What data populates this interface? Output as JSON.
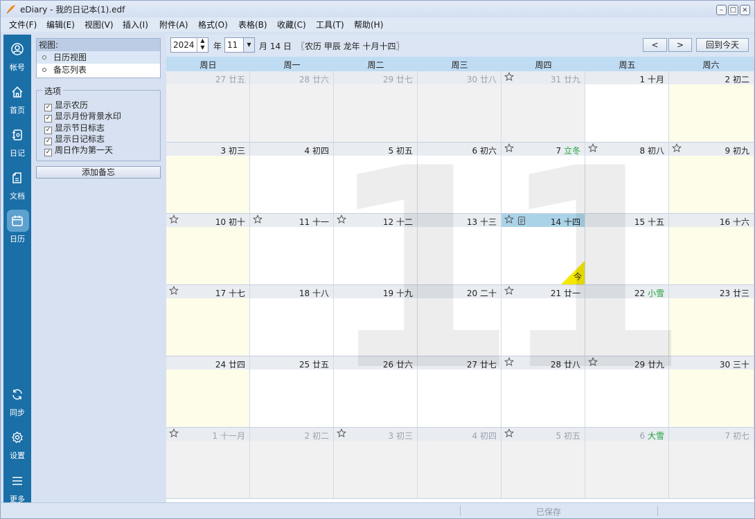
{
  "window": {
    "title": "eDiary - 我的日记本(1).edf"
  },
  "menu": [
    "文件(F)",
    "编辑(E)",
    "视图(V)",
    "插入(I)",
    "附件(A)",
    "格式(O)",
    "表格(B)",
    "收藏(C)",
    "工具(T)",
    "帮助(H)"
  ],
  "sidebar": {
    "items": [
      {
        "label": "帐号",
        "icon": "account-icon"
      },
      {
        "label": "首页",
        "icon": "home-icon"
      },
      {
        "label": "日记",
        "icon": "diary-icon"
      },
      {
        "label": "文档",
        "icon": "document-icon"
      },
      {
        "label": "日历",
        "icon": "calendar-icon",
        "active": true
      },
      {
        "label": "同步",
        "icon": "sync-icon"
      },
      {
        "label": "设置",
        "icon": "settings-icon"
      },
      {
        "label": "更多",
        "icon": "menu-icon"
      }
    ]
  },
  "panel": {
    "view_title": "视图:",
    "views": [
      "日历视图",
      "备忘列表"
    ],
    "options_title": "选项",
    "options": [
      {
        "label": "显示农历",
        "checked": true
      },
      {
        "label": "显示月份背景水印",
        "checked": true
      },
      {
        "label": "显示节日标志",
        "checked": true
      },
      {
        "label": "显示日记标志",
        "checked": true
      },
      {
        "label": "周日作为第一天",
        "checked": true
      }
    ],
    "add_memo": "添加备忘"
  },
  "toolbar": {
    "year": "2024",
    "year_unit": "年",
    "month": "11",
    "month_day": "月 14 日",
    "lunar_info": "〖农历 甲辰 龙年 十月十四〗",
    "prev": "<",
    "next": ">",
    "today": "回到今天"
  },
  "calendar": {
    "watermark": "11",
    "weekdays": [
      "周日",
      "周一",
      "周二",
      "周三",
      "周四",
      "周五",
      "周六"
    ],
    "today_badge": "今",
    "weeks": [
      [
        {
          "d": "27",
          "l": "廿五",
          "other": true
        },
        {
          "d": "28",
          "l": "廿六",
          "other": true
        },
        {
          "d": "29",
          "l": "廿七",
          "other": true
        },
        {
          "d": "30",
          "l": "廿八",
          "other": true
        },
        {
          "d": "31",
          "l": "廿九",
          "other": true,
          "star": true
        },
        {
          "d": "1",
          "l": "十月"
        },
        {
          "d": "2",
          "l": "初二",
          "weekend": true
        }
      ],
      [
        {
          "d": "3",
          "l": "初三",
          "weekend": true
        },
        {
          "d": "4",
          "l": "初四"
        },
        {
          "d": "5",
          "l": "初五"
        },
        {
          "d": "6",
          "l": "初六"
        },
        {
          "d": "7",
          "l": "立冬",
          "term": true,
          "star": true
        },
        {
          "d": "8",
          "l": "初八",
          "star": true
        },
        {
          "d": "9",
          "l": "初九",
          "weekend": true,
          "star": true
        }
      ],
      [
        {
          "d": "10",
          "l": "初十",
          "weekend": true,
          "star": true
        },
        {
          "d": "11",
          "l": "十一",
          "star": true
        },
        {
          "d": "12",
          "l": "十二",
          "star": true
        },
        {
          "d": "13",
          "l": "十三"
        },
        {
          "d": "14",
          "l": "十四",
          "today": true,
          "star": true,
          "note": true
        },
        {
          "d": "15",
          "l": "十五"
        },
        {
          "d": "16",
          "l": "十六",
          "weekend": true
        }
      ],
      [
        {
          "d": "17",
          "l": "十七",
          "weekend": true,
          "star": true
        },
        {
          "d": "18",
          "l": "十八"
        },
        {
          "d": "19",
          "l": "十九"
        },
        {
          "d": "20",
          "l": "二十"
        },
        {
          "d": "21",
          "l": "廿一",
          "star": true
        },
        {
          "d": "22",
          "l": "小雪",
          "term": true
        },
        {
          "d": "23",
          "l": "廿三",
          "weekend": true
        }
      ],
      [
        {
          "d": "24",
          "l": "廿四",
          "weekend": true
        },
        {
          "d": "25",
          "l": "廿五"
        },
        {
          "d": "26",
          "l": "廿六"
        },
        {
          "d": "27",
          "l": "廿七"
        },
        {
          "d": "28",
          "l": "廿八",
          "star": true
        },
        {
          "d": "29",
          "l": "廿九",
          "star": true
        },
        {
          "d": "30",
          "l": "三十",
          "weekend": true
        }
      ],
      [
        {
          "d": "1",
          "l": "十一月",
          "other": true,
          "star": true
        },
        {
          "d": "2",
          "l": "初二",
          "other": true
        },
        {
          "d": "3",
          "l": "初三",
          "other": true,
          "star": true
        },
        {
          "d": "4",
          "l": "初四",
          "other": true
        },
        {
          "d": "5",
          "l": "初五",
          "other": true,
          "star": true
        },
        {
          "d": "6",
          "l": "大雪",
          "other": true,
          "term": true
        },
        {
          "d": "7",
          "l": "初七",
          "other": true
        }
      ]
    ]
  },
  "status": {
    "saved": "已保存"
  },
  "colors": {
    "sidebar": "#1a6fa7",
    "today_header": "#aad3e8",
    "weekend": "#fdfde9",
    "solar_term": "#1fa33a",
    "today_badge": "#f5e800"
  }
}
